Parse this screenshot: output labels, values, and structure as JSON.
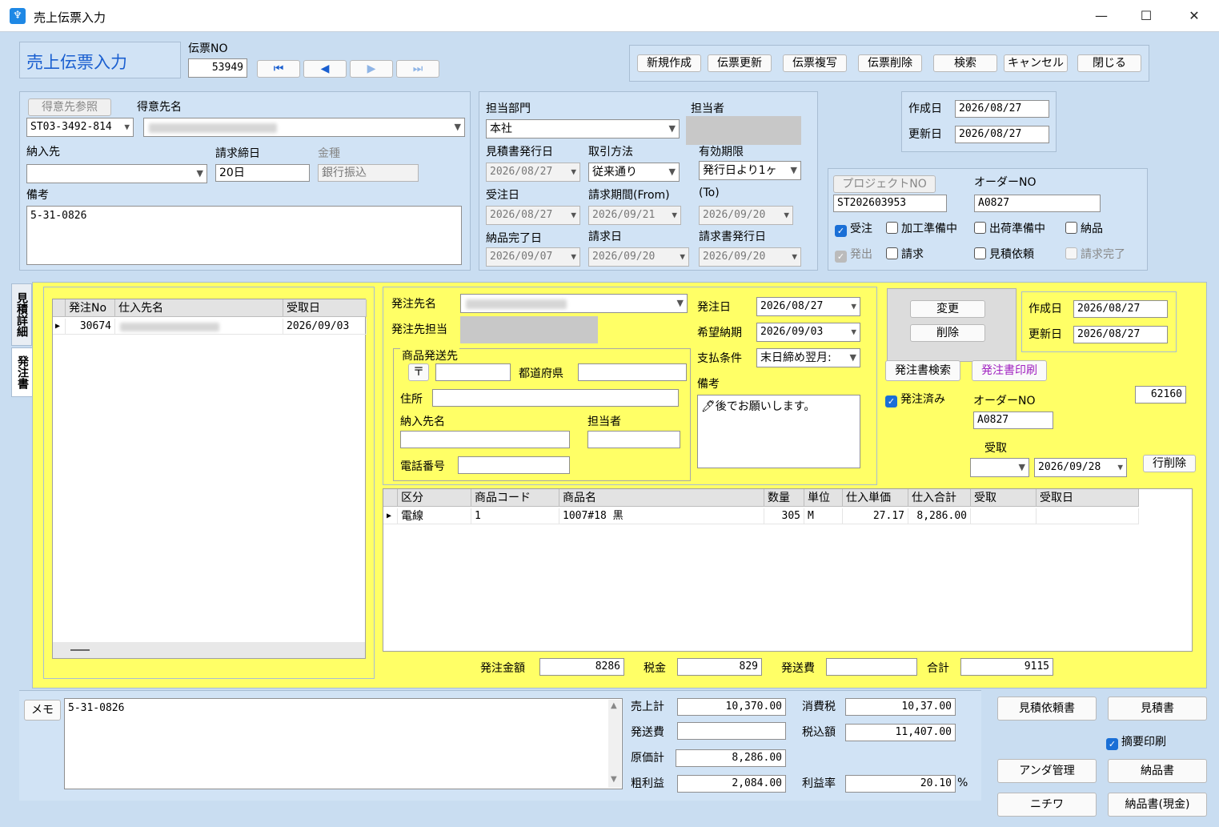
{
  "window": {
    "title": "売上伝票入力",
    "icon": "app-tooth-icon"
  },
  "header": {
    "title": "売上伝票入力",
    "denpyo_no_label": "伝票NO",
    "denpyo_no": "53949",
    "nav": [
      "first-icon",
      "prev-icon",
      "next-icon",
      "last-icon"
    ],
    "buttons": {
      "new": "新規作成",
      "update": "伝票更新",
      "copy": "伝票複写",
      "delete": "伝票削除",
      "search": "検索",
      "cancel": "キャンセル",
      "close": "閉じる"
    }
  },
  "customer": {
    "ref_btn": "得意先参照",
    "name_label": "得意先名",
    "code": "ST03-3492-814",
    "delivery_label": "納入先",
    "cutoff_label": "請求締日",
    "cutoff": "20日",
    "money_label": "金種",
    "money": "銀行振込",
    "memo_label": "備考",
    "memo": "5-31-0826"
  },
  "dept": {
    "dept_label": "担当部門",
    "dept": "本社",
    "staff_label": "担当者",
    "quote_date_label": "見積書発行日",
    "quote_date": "2026/08/27",
    "method_label": "取引方法",
    "method": "従来通り",
    "valid_label": "有効期限",
    "valid": "発行日より1ヶ",
    "order_date_label": "受注日",
    "order_date": "2026/08/27",
    "bill_from_label": "請求期間(From)",
    "bill_from": "2026/09/21",
    "bill_to_label": "(To)",
    "bill_to": "2026/09/20",
    "deliv_done_label": "納品完了日",
    "deliv_done": "2026/09/07",
    "bill_date_label": "請求日",
    "bill_date": "2026/09/20",
    "invoice_date_label": "請求書発行日",
    "invoice_date": "2026/09/20"
  },
  "dates": {
    "created_label": "作成日",
    "created": "2026/08/27",
    "updated_label": "更新日",
    "updated": "2026/08/27"
  },
  "project": {
    "btn": "プロジェクトNO",
    "no": "ST202603953",
    "order_no_label": "オーダーNO",
    "order_no": "A0827",
    "checks": {
      "juchu": "受注",
      "kakou": "加工準備中",
      "shukka": "出荷準備中",
      "nouhin": "納品",
      "hacchu": "発出",
      "seikyu": "請求",
      "mitsumori": "見積依頼",
      "seikyu_done": "請求完了"
    }
  },
  "tabs": {
    "detail": "見積詳細",
    "order": "発注書"
  },
  "po_list": {
    "headers": [
      "発注No",
      "仕入先名",
      "受取日"
    ],
    "rows": [
      {
        "no": "30674",
        "date": "2026/09/03"
      }
    ]
  },
  "po": {
    "supplier_label": "発注先名",
    "supplier_staff_label": "発注先担当",
    "ship_group": "商品発送先",
    "postal_btn": "〒",
    "pref_label": "都道府県",
    "addr_label": "住所",
    "deliv_name_label": "納入先名",
    "tantou_label": "担当者",
    "tel_label": "電話番号",
    "order_date_label": "発注日",
    "order_date": "2026/08/27",
    "hope_label": "希望納期",
    "hope": "2026/09/03",
    "pay_label": "支払条件",
    "pay": "末日締め翌月:",
    "memo_label": "備考",
    "memo": "🖊後でお願いします。"
  },
  "po_side": {
    "change": "変更",
    "delete": "削除",
    "created_label": "作成日",
    "created": "2026/08/27",
    "updated_label": "更新日",
    "updated": "2026/08/27",
    "search_btn": "発注書検索",
    "print_btn": "発注書印刷",
    "ordered": "発注済み",
    "order_no_label": "オーダーNO",
    "order_no": "A0827",
    "num": "62160",
    "receive_label": "受取",
    "receive_date": "2026/09/28",
    "row_del": "行削除"
  },
  "items": {
    "headers": [
      "区分",
      "商品コード",
      "商品名",
      "数量",
      "単位",
      "仕入単価",
      "仕入合計",
      "受取",
      "受取日"
    ],
    "rows": [
      {
        "kubun": "電線",
        "code": "1",
        "name": "1007#18 黒",
        "qty": "305",
        "unit": "M",
        "price": "27.17",
        "total": "8,286.00"
      }
    ]
  },
  "po_totals": {
    "amount_label": "発注金額",
    "amount": "8286",
    "tax_label": "税金",
    "tax": "829",
    "ship_label": "発送費",
    "total_label": "合計",
    "total": "9115"
  },
  "memo": {
    "btn": "メモ",
    "text": "5-31-0826"
  },
  "totals": {
    "sales_label": "売上計",
    "sales": "10,370.00",
    "ctax_label": "消費税",
    "ctax": "10,37.00",
    "ship_label": "発送費",
    "incl_label": "税込額",
    "incl": "11,407.00",
    "cost_label": "原価計",
    "cost": "8,286.00",
    "profit_label": "粗利益",
    "profit": "2,084.00",
    "rate_label": "利益率",
    "rate": "20.10",
    "pct": "%"
  },
  "right_btns": {
    "quote_req": "見積依頼書",
    "quote": "見積書",
    "summary": "摘要印刷",
    "under": "アンダ管理",
    "delivery": "納品書",
    "nichiwa": "ニチワ",
    "delivery_cash": "納品書(現金)"
  },
  "colors": {
    "accent": "#1a6fd6",
    "yellow": "#ffff66",
    "purple": "#a020c0"
  }
}
